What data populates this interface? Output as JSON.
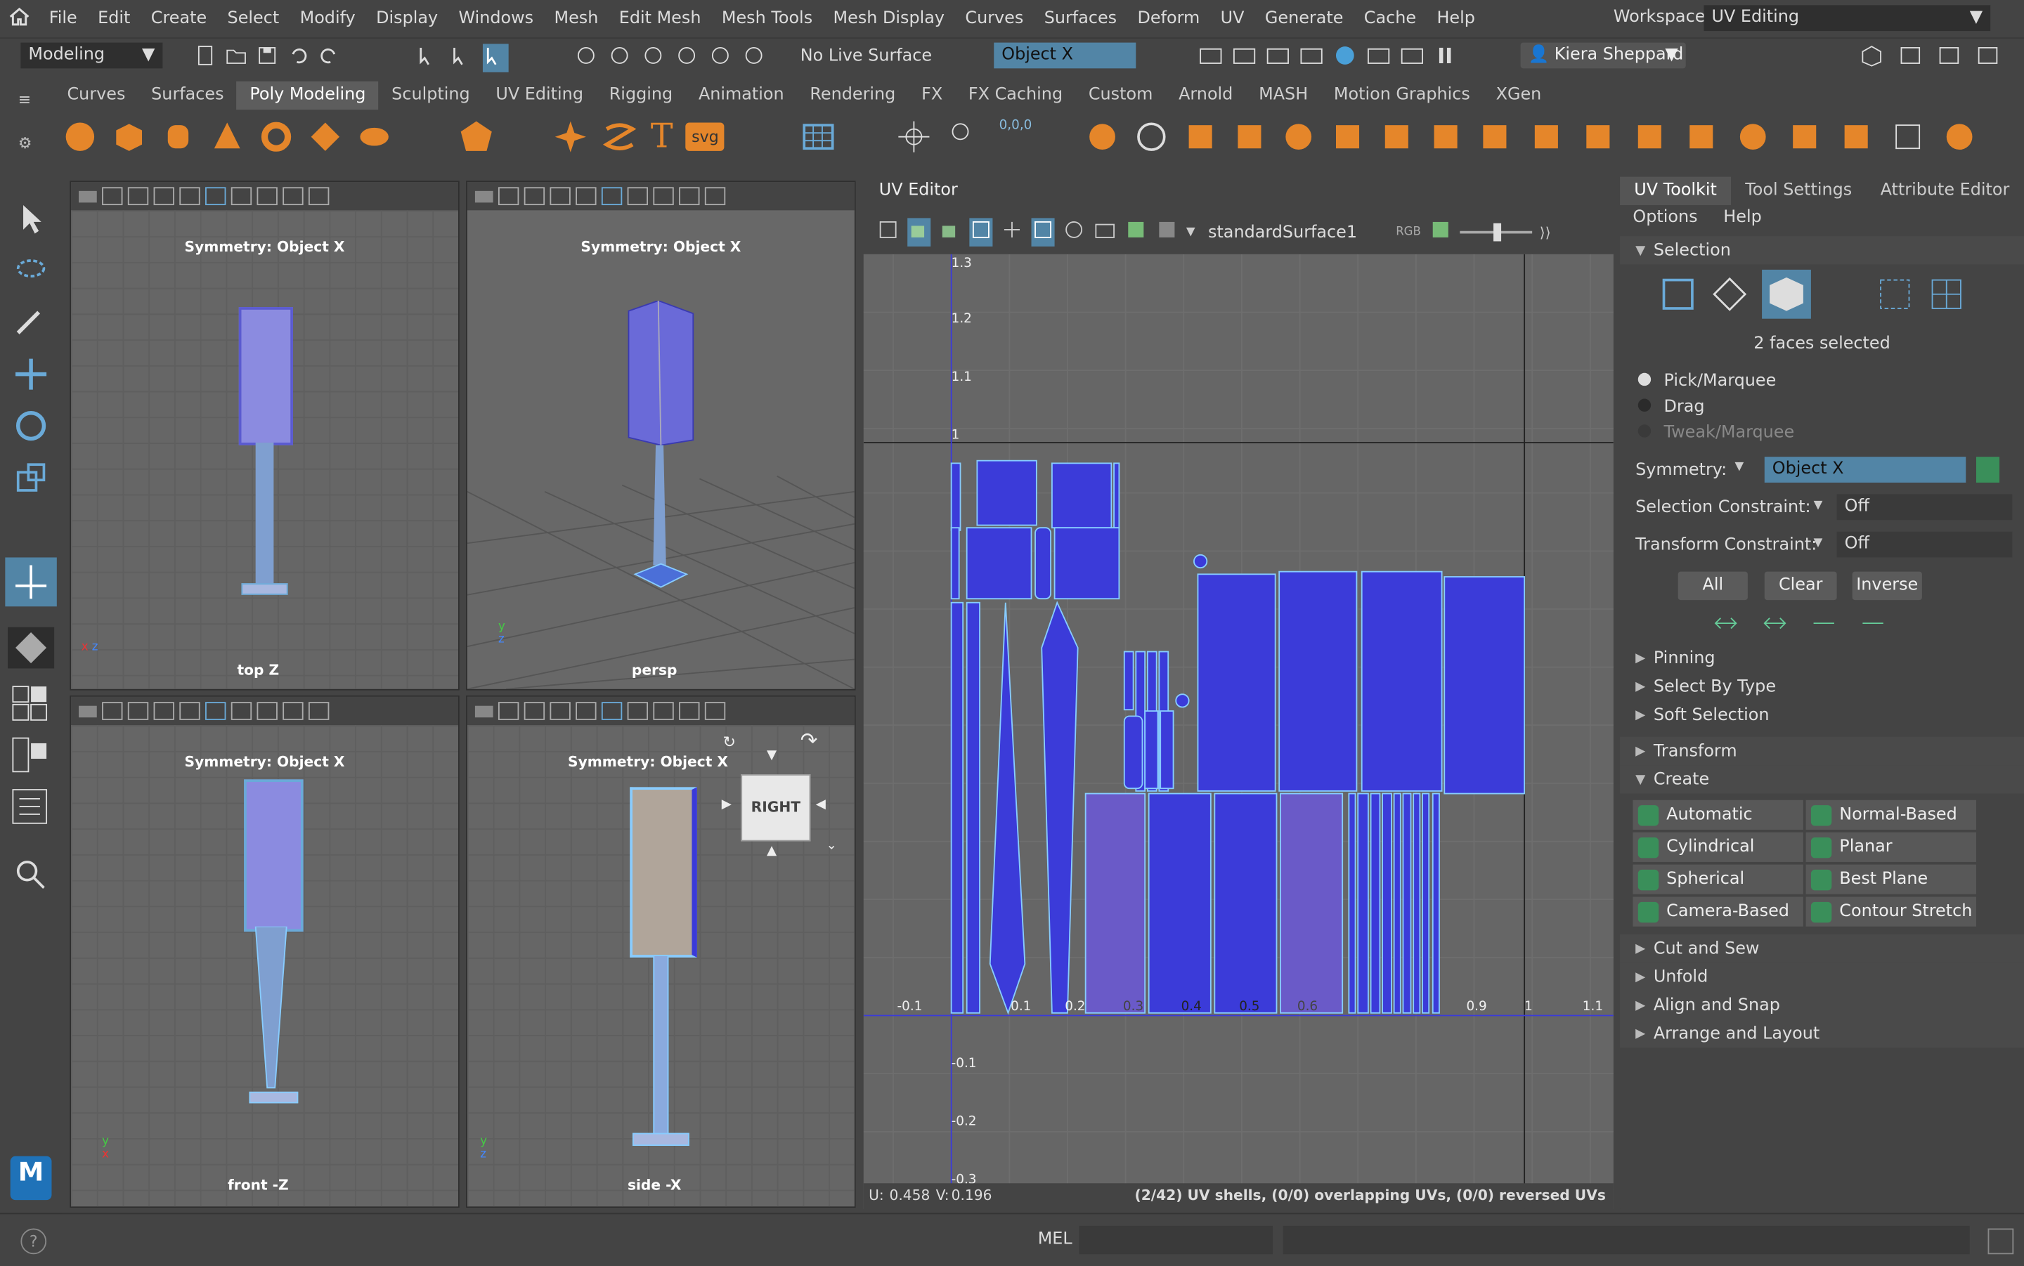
{
  "menubar": {
    "items": [
      "File",
      "Edit",
      "Create",
      "Select",
      "Modify",
      "Display",
      "Windows",
      "Mesh",
      "Edit Mesh",
      "Mesh Tools",
      "Mesh Display",
      "Curves",
      "Surfaces",
      "Deform",
      "UV",
      "Generate",
      "Cache",
      "Help"
    ],
    "workspace_label": "Workspace:",
    "workspace_value": "UV Editing"
  },
  "statusline": {
    "mode": "Modeling",
    "live_surface": "No Live Surface",
    "symmetry_field": "Object X",
    "user": "Kiera Sheppard"
  },
  "shelf": {
    "tabs": [
      "Curves",
      "Surfaces",
      "Poly Modeling",
      "Sculpting",
      "UV Editing",
      "Rigging",
      "Animation",
      "Rendering",
      "FX",
      "FX Caching",
      "Custom",
      "Arnold",
      "MASH",
      "Motion Graphics",
      "XGen"
    ],
    "active_tab": "Poly Modeling",
    "svg_label": "svg",
    "coord_label": "0,0,0"
  },
  "viewports": {
    "top": {
      "symmetry": "Symmetry: Object X",
      "camera": "top Z"
    },
    "persp": {
      "symmetry": "Symmetry: Object X",
      "camera": "persp"
    },
    "front": {
      "symmetry": "Symmetry: Object X",
      "camera": "front -Z"
    },
    "side": {
      "symmetry": "Symmetry: Object X",
      "camera": "side -X"
    },
    "viewcube_label": "RIGHT"
  },
  "uv_editor": {
    "title": "UV Editor",
    "material": "standardSurface1",
    "rgb_label": "RGB",
    "y_ticks": [
      "1.3",
      "1.2",
      "1.1",
      "1",
      "-0.1",
      "-0.2",
      "-0.3"
    ],
    "x_ticks": [
      "-0.1",
      "0.1",
      "0.2",
      "0.3",
      "0.4",
      "0.5",
      "0.6",
      "0.9",
      "1",
      "1.1"
    ],
    "status": "(2/42) UV shells, (0/0) overlapping UVs, (0/0) reversed UVs",
    "u_label": "U:",
    "u_value": "0.458",
    "v_label": "V:",
    "v_value": "0.196"
  },
  "right_panel": {
    "tabs": [
      "UV Toolkit",
      "Tool Settings",
      "Attribute Editor"
    ],
    "menu": [
      "Options",
      "Help"
    ],
    "selection_header": "Selection",
    "selected_text": "2 faces selected",
    "radio": [
      "Pick/Marquee",
      "Drag",
      "Tweak/Marquee"
    ],
    "symmetry_label": "Symmetry:",
    "symmetry_value": "Object X",
    "sel_constraint_label": "Selection Constraint:",
    "sel_constraint_value": "Off",
    "xf_constraint_label": "Transform Constraint:",
    "xf_constraint_value": "Off",
    "buttons": [
      "All",
      "Clear",
      "Inverse"
    ],
    "sections_collapsed_1": [
      "Pinning",
      "Select By Type",
      "Soft Selection",
      "Transform"
    ],
    "create_header": "Create",
    "create_buttons": [
      "Automatic",
      "Normal-Based",
      "Cylindrical",
      "Planar",
      "Spherical",
      "Best Plane",
      "Camera-Based",
      "Contour Stretch"
    ],
    "sections_collapsed_2": [
      "Cut and Sew",
      "Unfold",
      "Align and Snap",
      "Arrange and Layout"
    ]
  },
  "bottom": {
    "mel_label": "MEL",
    "help_icon": "?"
  },
  "colors": {
    "accent": "#3b3bd9",
    "select_field": "#5285a6",
    "uv_bg": "#666666"
  }
}
